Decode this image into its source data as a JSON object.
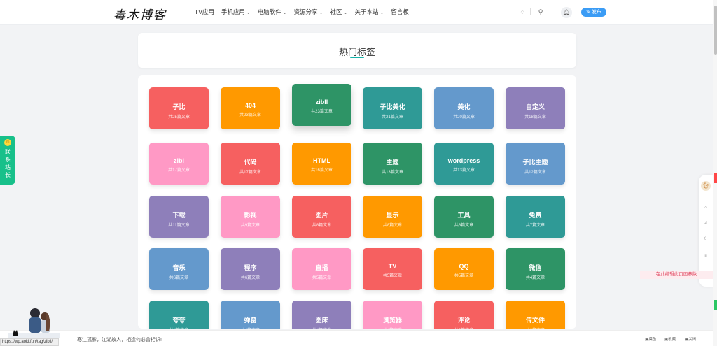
{
  "header": {
    "logo_text": "毒木博客",
    "nav": [
      {
        "label": "TV应用",
        "has_dropdown": false
      },
      {
        "label": "手机应用",
        "has_dropdown": true
      },
      {
        "label": "电脑软件",
        "has_dropdown": true
      },
      {
        "label": "资源分享",
        "has_dropdown": true
      },
      {
        "label": "社区",
        "has_dropdown": true
      },
      {
        "label": "关于本站",
        "has_dropdown": true
      },
      {
        "label": "留言板",
        "has_dropdown": false
      }
    ],
    "publish_label": "✎ 发布"
  },
  "page": {
    "title": "热门标签",
    "accent": "#17b3a9"
  },
  "tags": [
    {
      "name": "子比",
      "count": "共25篇文章",
      "color": "#f66060"
    },
    {
      "name": "404",
      "count": "共23篇文章",
      "color": "#ff9900"
    },
    {
      "name": "zibll",
      "count": "共23篇文章",
      "color": "#2e9466"
    },
    {
      "name": "子比美化",
      "count": "共21篇文章",
      "color": "#2f9a96"
    },
    {
      "name": "美化",
      "count": "共20篇文章",
      "color": "#6499cc"
    },
    {
      "name": "自定义",
      "count": "共18篇文章",
      "color": "#8e7fba"
    },
    {
      "name": "zibi",
      "count": "共17篇文章",
      "color": "#ff99c5"
    },
    {
      "name": "代码",
      "count": "共17篇文章",
      "color": "#f66060"
    },
    {
      "name": "HTML",
      "count": "共16篇文章",
      "color": "#ff9900"
    },
    {
      "name": "主题",
      "count": "共13篇文章",
      "color": "#2e9466"
    },
    {
      "name": "wordpress",
      "count": "共13篇文章",
      "color": "#2f9a96"
    },
    {
      "name": "子比主题",
      "count": "共12篇文章",
      "color": "#6499cc"
    },
    {
      "name": "下载",
      "count": "共11篇文章",
      "color": "#8e7fba"
    },
    {
      "name": "影视",
      "count": "共9篇文章",
      "color": "#ff99c5"
    },
    {
      "name": "图片",
      "count": "共8篇文章",
      "color": "#f66060"
    },
    {
      "name": "显示",
      "count": "共8篇文章",
      "color": "#ff9900"
    },
    {
      "name": "工具",
      "count": "共8篇文章",
      "color": "#2e9466"
    },
    {
      "name": "免费",
      "count": "共7篇文章",
      "color": "#2f9a96"
    },
    {
      "name": "音乐",
      "count": "共6篇文章",
      "color": "#6499cc"
    },
    {
      "name": "程序",
      "count": "共6篇文章",
      "color": "#8e7fba"
    },
    {
      "name": "直播",
      "count": "共5篇文章",
      "color": "#ff99c5"
    },
    {
      "name": "TV",
      "count": "共5篇文章",
      "color": "#f66060"
    },
    {
      "name": "QQ",
      "count": "共5篇文章",
      "color": "#ff9900"
    },
    {
      "name": "微信",
      "count": "共4篇文章",
      "color": "#2e9466"
    },
    {
      "name": "夸夸",
      "count": "共4篇文章",
      "color": "#2f9a96"
    },
    {
      "name": "弹窗",
      "count": "共4篇文章",
      "color": "#6499cc"
    },
    {
      "name": "图床",
      "count": "共4篇文章",
      "color": "#8e7fba"
    },
    {
      "name": "浏览器",
      "count": "共4篇文章",
      "color": "#ff99c5"
    },
    {
      "name": "评论",
      "count": "共3篇文章",
      "color": "#f66060"
    },
    {
      "name": "传文件",
      "count": "共3篇文章",
      "color": "#ff9900"
    }
  ],
  "contact_widget": {
    "label": "联系站长"
  },
  "float_bar": {
    "edit_hint": "在此编辑此页面参数"
  },
  "footer": {
    "quote": "寒江孤影，江湖故人，相逢何必曾相识!",
    "actions": [
      "▣摸鱼",
      "▣收藏",
      "▣关闭"
    ],
    "status_url": "https://wp.aoki.fun/tag/zibll/"
  }
}
